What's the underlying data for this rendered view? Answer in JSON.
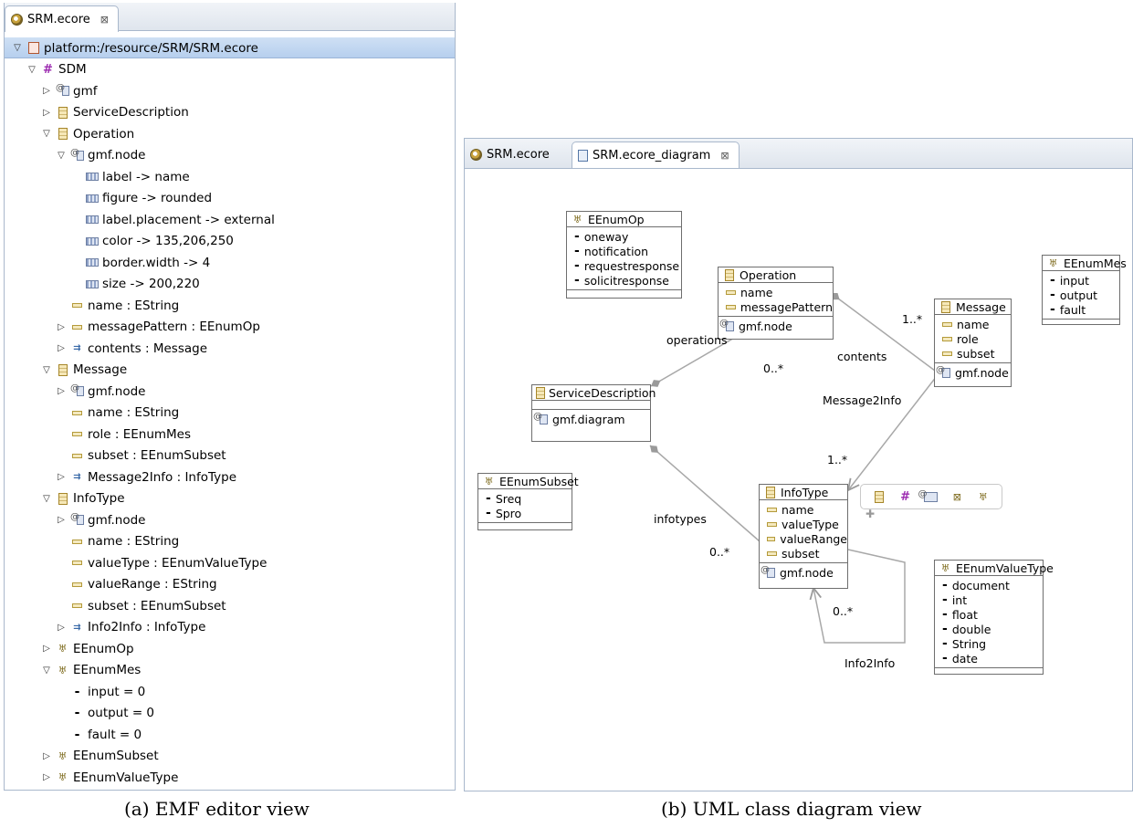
{
  "left_editor": {
    "tab_title": "SRM.ecore",
    "tab_close": "⊠",
    "tree": [
      {
        "label": "platform:/resource/SRM/SRM.ecore",
        "icon": "resource-icon",
        "level": 0,
        "twisty": "▽"
      },
      {
        "label": "SDM",
        "icon": "package-icon",
        "level": 1,
        "twisty": "▽"
      },
      {
        "label": "gmf",
        "icon": "annotation-icon",
        "level": 2,
        "twisty": "▷"
      },
      {
        "label": "ServiceDescription",
        "icon": "class-icon",
        "level": 2,
        "twisty": "▷"
      },
      {
        "label": "Operation",
        "icon": "class-icon",
        "level": 2,
        "twisty": "▽"
      },
      {
        "label": "gmf.node",
        "icon": "annotation-icon",
        "level": 3,
        "twisty": "▽"
      },
      {
        "label": "label -> name",
        "icon": "entry-icon",
        "level": 4,
        "twisty": ""
      },
      {
        "label": "figure -> rounded",
        "icon": "entry-icon",
        "level": 4,
        "twisty": ""
      },
      {
        "label": "label.placement -> external",
        "icon": "entry-icon",
        "level": 4,
        "twisty": ""
      },
      {
        "label": "color -> 135,206,250",
        "icon": "entry-icon",
        "level": 4,
        "twisty": ""
      },
      {
        "label": "border.width -> 4",
        "icon": "entry-icon",
        "level": 4,
        "twisty": ""
      },
      {
        "label": "size -> 200,220",
        "icon": "entry-icon",
        "level": 4,
        "twisty": ""
      },
      {
        "label": "name : EString",
        "icon": "attribute-icon",
        "level": 3,
        "twisty": ""
      },
      {
        "label": "messagePattern : EEnumOp",
        "icon": "attribute-icon",
        "level": 3,
        "twisty": "▷"
      },
      {
        "label": "contents : Message",
        "icon": "reference-icon",
        "level": 3,
        "twisty": "▷"
      },
      {
        "label": "Message",
        "icon": "class-icon",
        "level": 2,
        "twisty": "▽"
      },
      {
        "label": "gmf.node",
        "icon": "annotation-icon",
        "level": 3,
        "twisty": "▷"
      },
      {
        "label": "name : EString",
        "icon": "attribute-icon",
        "level": 3,
        "twisty": ""
      },
      {
        "label": "role : EEnumMes",
        "icon": "attribute-icon",
        "level": 3,
        "twisty": ""
      },
      {
        "label": "subset : EEnumSubset",
        "icon": "attribute-icon",
        "level": 3,
        "twisty": ""
      },
      {
        "label": "Message2Info : InfoType",
        "icon": "reference-icon",
        "level": 3,
        "twisty": "▷"
      },
      {
        "label": "InfoType",
        "icon": "class-icon",
        "level": 2,
        "twisty": "▽"
      },
      {
        "label": "gmf.node",
        "icon": "annotation-icon",
        "level": 3,
        "twisty": "▷"
      },
      {
        "label": "name : EString",
        "icon": "attribute-icon",
        "level": 3,
        "twisty": ""
      },
      {
        "label": "valueType : EEnumValueType",
        "icon": "attribute-icon",
        "level": 3,
        "twisty": ""
      },
      {
        "label": "valueRange : EString",
        "icon": "attribute-icon",
        "level": 3,
        "twisty": ""
      },
      {
        "label": "subset : EEnumSubset",
        "icon": "attribute-icon",
        "level": 3,
        "twisty": ""
      },
      {
        "label": "Info2Info : InfoType",
        "icon": "reference-icon",
        "level": 3,
        "twisty": "▷"
      },
      {
        "label": "EEnumOp",
        "icon": "enum-icon",
        "level": 2,
        "twisty": "▷"
      },
      {
        "label": "EEnumMes",
        "icon": "enum-icon",
        "level": 2,
        "twisty": "▽"
      },
      {
        "label": "input = 0",
        "icon": "literal-icon",
        "level": 3,
        "twisty": ""
      },
      {
        "label": "output = 0",
        "icon": "literal-icon",
        "level": 3,
        "twisty": ""
      },
      {
        "label": "fault = 0",
        "icon": "literal-icon",
        "level": 3,
        "twisty": ""
      },
      {
        "label": "EEnumSubset",
        "icon": "enum-icon",
        "level": 2,
        "twisty": "▷"
      },
      {
        "label": "EEnumValueType",
        "icon": "enum-icon",
        "level": 2,
        "twisty": "▷"
      }
    ]
  },
  "right_editor": {
    "tabs": [
      {
        "title": "SRM.ecore",
        "active": false
      },
      {
        "title": "SRM.ecore_diagram",
        "active": true,
        "close": "⊠"
      }
    ],
    "boxes": {
      "eenumop": {
        "title": "EEnumOp",
        "items": [
          "oneway",
          "notification",
          "requestresponse",
          "solicitresponse"
        ]
      },
      "operation": {
        "title": "Operation",
        "items": [
          "name",
          "messagePattern"
        ],
        "annotation": "gmf.node"
      },
      "eenummes": {
        "title": "EEnumMes",
        "items": [
          "input",
          "output",
          "fault"
        ]
      },
      "message": {
        "title": "Message",
        "items": [
          "name",
          "role",
          "subset"
        ],
        "annotation": "gmf.node"
      },
      "servicedescription": {
        "title": "ServiceDescription",
        "annotation": "gmf.diagram"
      },
      "eenumsubset": {
        "title": "EEnumSubset",
        "items": [
          "Sreq",
          "Spro"
        ]
      },
      "infotype": {
        "title": "InfoType",
        "items": [
          "name",
          "valueType",
          "valueRange",
          "subset"
        ],
        "annotation": "gmf.node"
      },
      "eenumvaluetype": {
        "title": "EEnumValueType",
        "items": [
          "document",
          "int",
          "float",
          "double",
          "String",
          "date"
        ]
      }
    },
    "edge_labels": {
      "operations": "operations",
      "operations_mult": "0..*",
      "contents": "contents",
      "contents_mult": "1..*",
      "message2info": "Message2Info",
      "message2info_mult": "1..*",
      "infotypes": "infotypes",
      "infotypes_mult": "0..*",
      "info2info": "Info2Info",
      "info2info_mult": "0..*"
    }
  },
  "captions": {
    "a": "(a) EMF editor view",
    "b": "(b) UML class diagram view"
  }
}
